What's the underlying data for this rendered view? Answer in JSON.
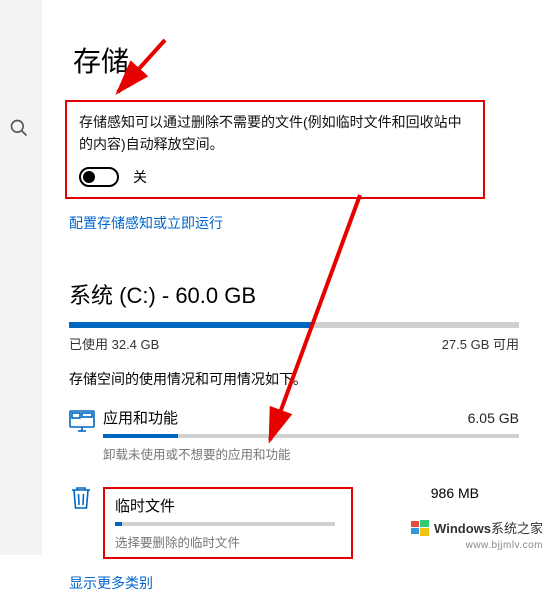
{
  "page_title": "存储",
  "storage_sense": {
    "description": "存储感知可以通过删除不需要的文件(例如临时文件和回收站中的内容)自动释放空间。",
    "toggle_state": "关",
    "config_link": "配置存储感知或立即运行"
  },
  "system_drive": {
    "title": "系统 (C:) - 60.0 GB",
    "used_label": "已使用 32.4 GB",
    "free_label": "27.5 GB 可用",
    "fill_percent": 54,
    "usage_desc": "存储空间的使用情况和可用情况如下。"
  },
  "categories": [
    {
      "name": "应用和功能",
      "size": "6.05 GB",
      "sub": "卸载未使用或不想要的应用和功能",
      "fill_percent": 18,
      "icon": "apps"
    },
    {
      "name": "临时文件",
      "size": "986 MB",
      "sub": "选择要删除的临时文件",
      "fill_percent": 3,
      "icon": "trash"
    }
  ],
  "more_link": "显示更多类别",
  "watermark": {
    "brand": "Windows",
    "suffix": "系统之家",
    "url": "www.bjjmlv.com"
  }
}
